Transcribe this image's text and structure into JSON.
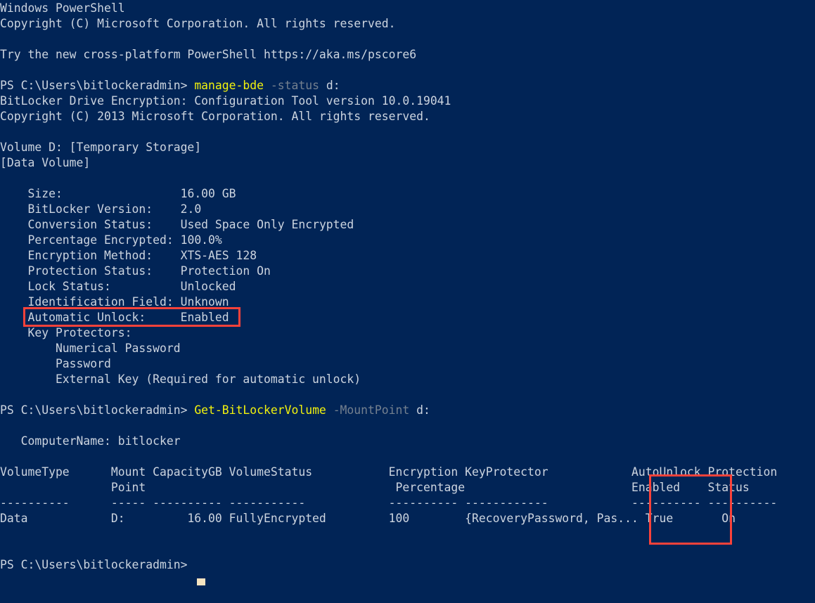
{
  "window": {
    "title": "Windows PowerShell",
    "background_color": "#012456",
    "foreground_color": "#ccd4df",
    "command_color": "#f2f20d",
    "parameter_color": "#74808f",
    "highlight_color": "#f9423a",
    "cursor_color": "#f5e3c0"
  },
  "banner": {
    "line1": "Windows PowerShell",
    "line2": "Copyright (C) Microsoft Corporation. All rights reserved.",
    "line3": "",
    "line4": "Try the new cross-platform PowerShell https://aka.ms/pscore6",
    "line5": ""
  },
  "prompts": {
    "path": "PS C:\\Users\\bitlockeradmin>"
  },
  "command1": {
    "prompt": "PS C:\\Users\\bitlockeradmin> ",
    "name": "manage-bde",
    "space1": " ",
    "parameter": "-status",
    "space2": " ",
    "argument": "d:"
  },
  "manage_bde_output": {
    "header1": "BitLocker Drive Encryption: Configuration Tool version 10.0.19041",
    "header2": "Copyright (C) 2013 Microsoft Corporation. All rights reserved.",
    "blank1": "",
    "volume_line": "Volume D: [Temporary Storage]",
    "volume_type": "[Data Volume]",
    "blank2": "",
    "fields": [
      {
        "label": "    Size:                 ",
        "value": "16.00 GB"
      },
      {
        "label": "    BitLocker Version:    ",
        "value": "2.0"
      },
      {
        "label": "    Conversion Status:    ",
        "value": "Used Space Only Encrypted"
      },
      {
        "label": "    Percentage Encrypted: ",
        "value": "100.0%"
      },
      {
        "label": "    Encryption Method:    ",
        "value": "XTS-AES 128"
      },
      {
        "label": "    Protection Status:    ",
        "value": "Protection On"
      },
      {
        "label": "    Lock Status:          ",
        "value": "Unlocked"
      },
      {
        "label": "    Identification Field: ",
        "value": "Unknown"
      },
      {
        "label": "    Automatic Unlock:     ",
        "value": "Enabled"
      }
    ],
    "key_protectors_label": "    Key Protectors:",
    "key_protectors": [
      "        Numerical Password",
      "        Password",
      "        External Key (Required for automatic unlock)"
    ],
    "blank3": ""
  },
  "command2": {
    "prompt": "PS C:\\Users\\bitlockeradmin> ",
    "name": "Get-BitLockerVolume",
    "space1": " ",
    "parameter": "-MountPoint",
    "space2": " ",
    "argument": "d:"
  },
  "get_bitlockervolume_output": {
    "blank1": "",
    "computer_name_line": "   ComputerName: bitlocker",
    "blank2": "",
    "table": {
      "header_row1": "VolumeType      Mount CapacityGB VolumeStatus           Encryption KeyProtector            AutoUnlock Protection",
      "header_row2": "                Point                                    Percentage                        Enabled    Status",
      "separator_row": "----------      ----- ---------- -----------            ---------- ------------            ---------- ----------",
      "data_row": "Data            D:         16.00 FullyEncrypted         100        {RecoveryPassword, Pas... True       On",
      "columns": [
        {
          "header": "VolumeType",
          "header2": "",
          "value": "Data"
        },
        {
          "header": "Mount",
          "header2": "Point",
          "value": "D:"
        },
        {
          "header": "CapacityGB",
          "header2": "",
          "value": "16.00"
        },
        {
          "header": "VolumeStatus",
          "header2": "",
          "value": "FullyEncrypted"
        },
        {
          "header": "Encryption",
          "header2": "Percentage",
          "value": "100"
        },
        {
          "header": "KeyProtector",
          "header2": "",
          "value": "{RecoveryPassword, Pas..."
        },
        {
          "header": "AutoUnlock",
          "header2": "Enabled",
          "value": "True"
        },
        {
          "header": "Protection",
          "header2": "Status",
          "value": "On"
        }
      ]
    },
    "blank3": "",
    "blank4": ""
  },
  "command3": {
    "prompt": "PS C:\\Users\\bitlockeradmin> ",
    "cursor": "█"
  },
  "annotations": [
    {
      "name": "automatic-unlock-highlight",
      "target_text": "Automatic Unlock:     Enabled"
    },
    {
      "name": "autounlock-column-highlight",
      "target_text": "AutoUnlock Enabled / True"
    }
  ]
}
